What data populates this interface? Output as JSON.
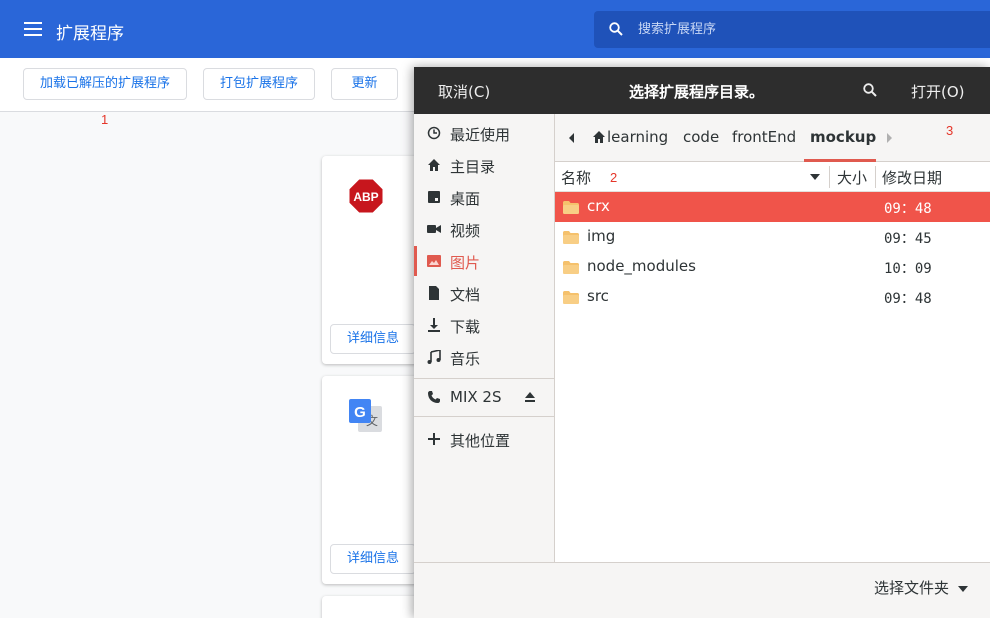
{
  "page": {
    "title": "扩展程序",
    "search_placeholder": "搜索扩展程序"
  },
  "toolbar": {
    "load_unpacked": "加载已解压的扩展程序",
    "pack": "打包扩展程序",
    "update": "更新"
  },
  "annotations": {
    "a1": "1",
    "a2": "2",
    "a3": "3"
  },
  "extensions": [
    {
      "icon": "abp-icon",
      "logo_text": "ABP",
      "details_label": "详细信息"
    },
    {
      "icon": "google-translate-icon",
      "logo_text": "文",
      "details_label": "详细信息"
    }
  ],
  "dialog": {
    "cancel": "取消(C)",
    "title": "选择扩展程序目录。",
    "open": "打开(O)",
    "sidebar": [
      {
        "label": "最近使用",
        "icon": "clock-icon"
      },
      {
        "label": "主目录",
        "icon": "home-icon"
      },
      {
        "label": "桌面",
        "icon": "desktop-icon"
      },
      {
        "label": "视频",
        "icon": "video-icon"
      },
      {
        "label": "图片",
        "icon": "image-icon",
        "active": true
      },
      {
        "label": "文档",
        "icon": "document-icon"
      },
      {
        "label": "下载",
        "icon": "download-icon"
      },
      {
        "label": "音乐",
        "icon": "music-icon"
      }
    ],
    "device": {
      "label": "MIX 2S",
      "icon": "phone-icon"
    },
    "other_locations": "其他位置",
    "breadcrumbs": [
      "learning",
      "code",
      "frontEnd",
      "mockup"
    ],
    "columns": {
      "name": "名称",
      "size": "大小",
      "modified": "修改日期"
    },
    "files": [
      {
        "name": "crx",
        "modified": "09：48",
        "selected": true
      },
      {
        "name": "img",
        "modified": "09：45",
        "selected": false
      },
      {
        "name": "node_modules",
        "modified": "10：09",
        "selected": false
      },
      {
        "name": "src",
        "modified": "09：48",
        "selected": false
      }
    ],
    "filter": "选择文件夹"
  },
  "colors": {
    "chrome_blue": "#2a66d8",
    "header_dark": "#2d2d2d",
    "selection": "#f0544a",
    "link_blue": "#1a73e8"
  }
}
